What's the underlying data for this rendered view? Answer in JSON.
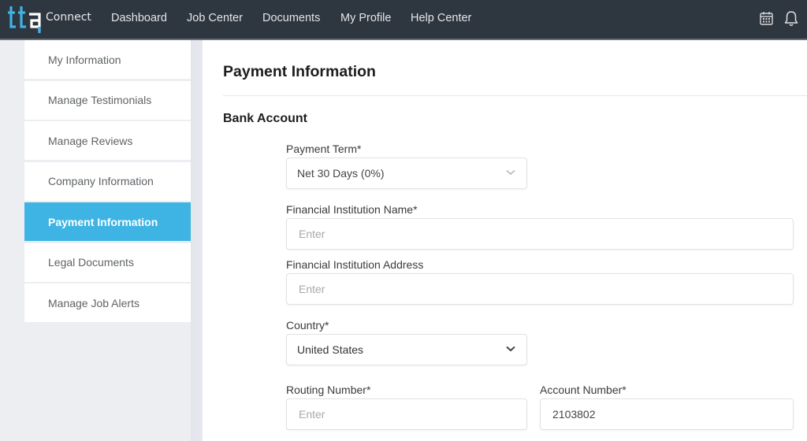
{
  "brand": {
    "logo_text": "tta",
    "product_name": "Connect",
    "colors": {
      "logo_blue": "#3db4e4",
      "logo_white": "#ffffff",
      "nav_bg": "#2e3640",
      "active_blue": "#3db4e4"
    }
  },
  "nav": {
    "items": [
      {
        "label": "Dashboard"
      },
      {
        "label": "Job Center"
      },
      {
        "label": "Documents"
      },
      {
        "label": "My Profile"
      },
      {
        "label": "Help Center"
      }
    ],
    "icons": [
      "calendar-icon",
      "bell-icon"
    ]
  },
  "sidebar": {
    "items": [
      {
        "label": "My Information",
        "active": false
      },
      {
        "label": "Manage Testimonials",
        "active": false
      },
      {
        "label": "Manage Reviews",
        "active": false
      },
      {
        "label": "Company Information",
        "active": false
      },
      {
        "label": "Payment Information",
        "active": true
      },
      {
        "label": "Legal Documents",
        "active": false
      },
      {
        "label": "Manage Job Alerts",
        "active": false
      }
    ]
  },
  "main": {
    "title": "Payment Information",
    "section_title": "Bank Account",
    "fields": {
      "payment_term": {
        "label": "Payment Term*",
        "value": "Net 30 Days (0%)"
      },
      "institution_name": {
        "label": "Financial Institution Name*",
        "placeholder": "Enter",
        "value": ""
      },
      "institution_address": {
        "label": "Financial Institution Address",
        "placeholder": "Enter",
        "value": ""
      },
      "country": {
        "label": "Country*",
        "value": "United States"
      },
      "routing_number": {
        "label": "Routing Number*",
        "placeholder": "Enter",
        "value": ""
      },
      "account_number": {
        "label": "Account Number*",
        "value": "2103802"
      }
    }
  }
}
